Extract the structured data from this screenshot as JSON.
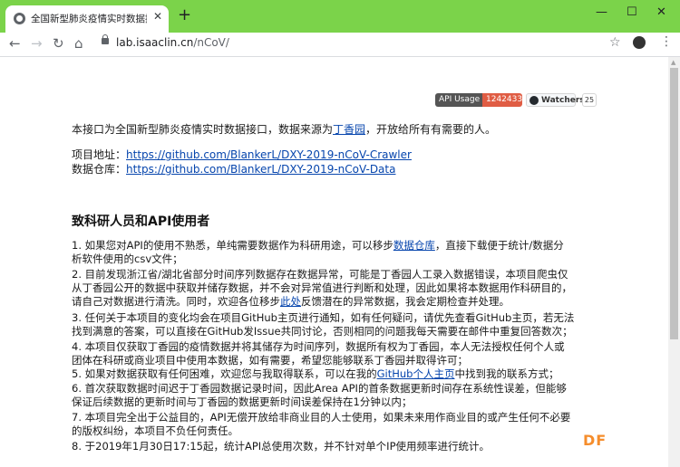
{
  "browser": {
    "tab_title": "全国新型肺炎疫情实时数据接口",
    "tab_close": "✕",
    "new_tab": "+",
    "url_host": "lab.isaaclin.cn",
    "url_path": "/nCoV/",
    "win_min": "—",
    "win_max": "☐",
    "win_close": "✕"
  },
  "badges": {
    "api_label": "API Usage",
    "api_value": "1242433",
    "watchers_label": "Watchers",
    "watchers_count": "25"
  },
  "intro": {
    "prefix": "本接口为全国新型肺炎疫情实时数据接口，数据来源为",
    "link": "丁香园",
    "suffix": "，开放给所有有需要的人。"
  },
  "project": {
    "label": "项目地址：",
    "url": "https://github.com/BlankerL/DXY-2019-nCoV-Crawler"
  },
  "data_repo": {
    "label": "数据仓库：",
    "url": "https://github.com/BlankerL/DXY-2019-nCoV-Data"
  },
  "heading": "致科研人员和API使用者",
  "items": {
    "i1_a": "1. 如果您对API的使用不熟悉，单纯需要数据作为科研用途，可以移步",
    "i1_link": "数据仓库",
    "i1_b": "，直接下载便于统计/数据分\n析软件使用的csv文件；",
    "i2_a": "2. 目前发现浙江省/湖北省部分时间序列数据存在数据异常，可能是丁香园人工录入数据错误，本项目爬虫仅\n从丁香园公开的数据中获取并储存数据，并不会对异常值进行判断和处理，因此如果将本数据用作科研目的，\n请自己对数据进行清洗。同时，欢迎各位移步",
    "i2_link": "此处",
    "i2_b": "反馈潜在的异常数据，我会定期检查并处理。",
    "i3": "3. 任何关于本项目的变化均会在项目GitHub主页进行通知，如有任何疑问，请优先查看GitHub主页，若无法\n找到满意的答案，可以直接在GitHub发Issue共同讨论，否则相同的问题我每天需要在邮件中重复回答数次；",
    "i4": "4. 本项目仅获取丁香园的疫情数据并将其储存为时间序列，数据所有权为丁香园，本人无法授权任何个人或\n团体在科研或商业项目中使用本数据，如有需要，希望您能够联系丁香园并取得许可；",
    "i5_a": "5. 如果对数据获取有任何困难，欢迎您与我取得联系，可以在我的",
    "i5_link": "GitHub个人主页",
    "i5_b": "中找到我的联系方式；",
    "i6": "6. 首次获取数据时间迟于丁香园数据记录时间，因此Area API的首条数据更新时间存在系统性误差，但能够\n保证后续数据的更新时间与丁香园的数据更新时间误差保持在1分钟以内；",
    "i7": "7. 本项目完全出于公益目的，API无偿开放给非商业目的人士使用，如果未来用作商业目的或产生任何不必要\n的版权纠纷，本项目不负任何责任。",
    "i8": "8. 于2019年1月30日17:15起，统计API总使用次数，并不针对单个IP使用频率进行统计。"
  },
  "watermark": "DF"
}
